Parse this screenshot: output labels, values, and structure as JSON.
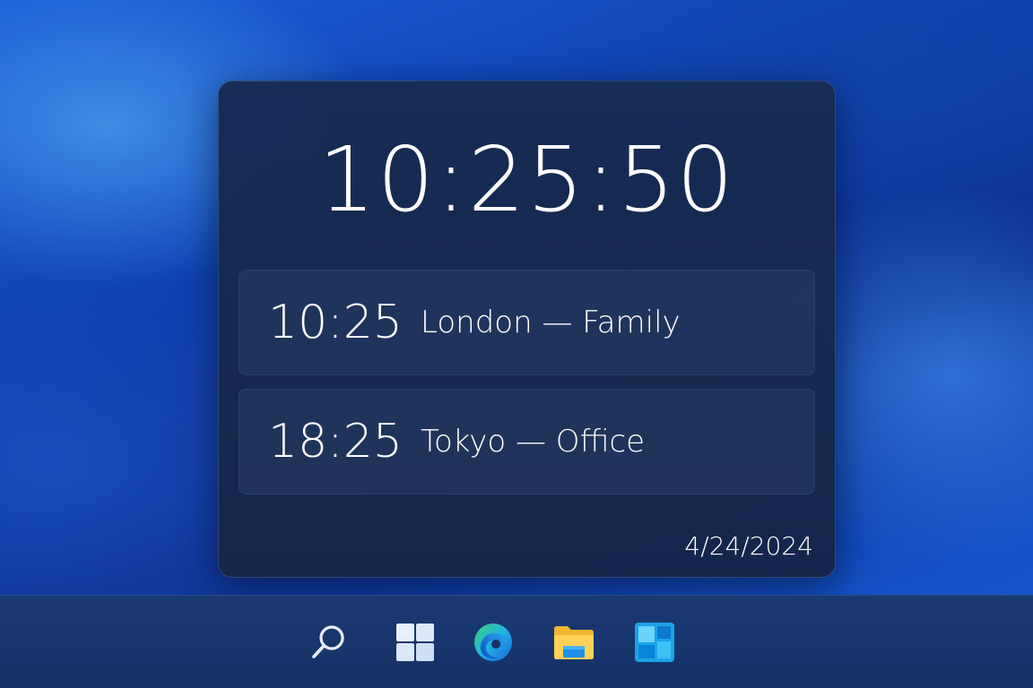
{
  "widget": {
    "main_time": "10:25:50",
    "zones": [
      {
        "time": "10:25",
        "label": "London — Family"
      },
      {
        "time": "18:25",
        "label": "Tokyo — Office"
      }
    ],
    "date": "4/24/2024"
  },
  "taskbar": {
    "icons": [
      "search-icon",
      "start-icon",
      "edge-icon",
      "file-explorer-icon",
      "widgets-icon"
    ]
  },
  "colors": {
    "widget_background": "#162b52",
    "taskbar_background": "#1b3a73",
    "text": "#ffffff"
  }
}
